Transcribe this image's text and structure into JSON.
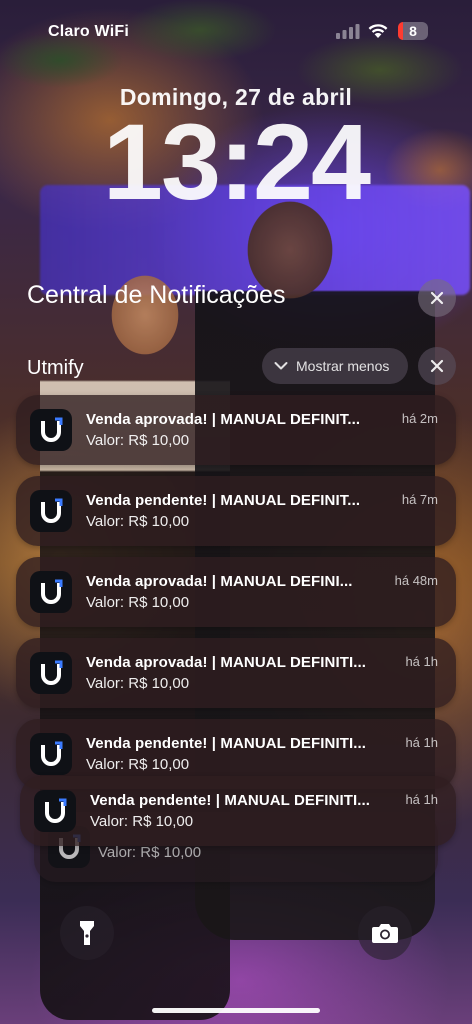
{
  "status_bar": {
    "carrier": "Claro WiFi",
    "battery": "8",
    "battery_level": 0.08,
    "battery_color": "#ff3b30"
  },
  "lock_screen": {
    "date": "Domingo, 27 de abril",
    "time": "13:24"
  },
  "notification_center": {
    "title": "Central de Notificações",
    "close_icon": "close-icon"
  },
  "group": {
    "app_name": "Utmify",
    "show_less_label": "Mostrar menos",
    "close_icon": "close-icon"
  },
  "notifications": [
    {
      "title": "Venda aprovada! | MANUAL DEFINIT...",
      "body": "Valor: R$ 10,00",
      "time": "há 2m"
    },
    {
      "title": "Venda pendente! | MANUAL DEFINIT...",
      "body": "Valor: R$ 10,00",
      "time": "há 7m"
    },
    {
      "title": "Venda aprovada! | MANUAL DEFINI...",
      "body": "Valor: R$ 10,00",
      "time": "há 48m"
    },
    {
      "title": "Venda aprovada! | MANUAL DEFINITI...",
      "body": "Valor: R$ 10,00",
      "time": "há 1h"
    },
    {
      "title": "Venda pendente! | MANUAL DEFINITI...",
      "body": "Valor: R$ 10,00",
      "time": "há 1h"
    },
    {
      "title": "Venda pendente! | MANUAL DEFINITI...",
      "body": "Valor: R$ 10,00",
      "time": "há 1h"
    }
  ],
  "stacked_peek": {
    "body": "Valor: R$ 10,00"
  },
  "quick_actions": {
    "left_icon": "flashlight-icon",
    "right_icon": "camera-icon"
  }
}
